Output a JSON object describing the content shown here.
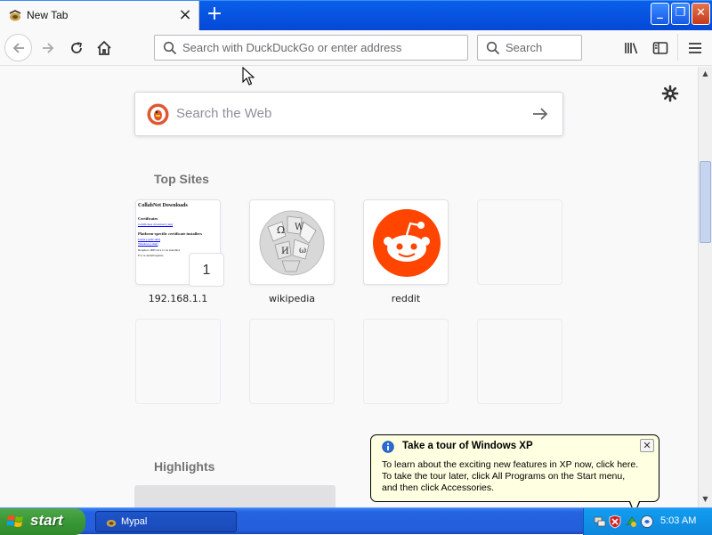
{
  "window": {
    "tab_title": "New Tab",
    "tab_close": "×",
    "new_tab": "+",
    "min_label": "_",
    "max_label": "❐",
    "close_label": "✕"
  },
  "toolbar": {
    "url_placeholder": "Search with DuckDuckGo or enter address",
    "search_placeholder": "Search"
  },
  "newtab": {
    "web_search_placeholder": "Search the Web",
    "top_sites_heading": "Top Sites",
    "highlights_heading": "Highlights",
    "top_sites": [
      {
        "label": "192.168.1.1",
        "badge": "1"
      },
      {
        "label": "wikipedia"
      },
      {
        "label": "reddit"
      }
    ],
    "thumbnail": {
      "heading": "CollabNet Downloads",
      "certificates": "Certificates",
      "cert_link": "Certificates download (.zip)",
      "platform": "Platform-specific certificate installers",
      "links": [
        "Linux (.rpm/.deb)",
        "Windows (.msi)"
      ],
      "lines": [
        "Requires JRE/Java to be installed",
        "For re-install/update"
      ]
    }
  },
  "balloon": {
    "title": "Take a tour of Windows XP",
    "close_label": "✕",
    "line1": "To learn about the exciting new features in XP now, click here.",
    "line2": "To take the tour later, click All Programs on the Start menu,",
    "line3": "and then click Accessories."
  },
  "taskbar": {
    "start_label": "start",
    "task_label": "Mypal",
    "clock": "5:03 AM"
  },
  "colors": {
    "xp_blue": "#0448d6",
    "start_green": "#3c9a3a",
    "reddit_orange": "#ff4500",
    "ddg_orange": "#de5833",
    "balloon_yellow": "#ffffe1"
  },
  "scroll": {
    "up_arrow": "▲",
    "down_arrow": "▼"
  }
}
